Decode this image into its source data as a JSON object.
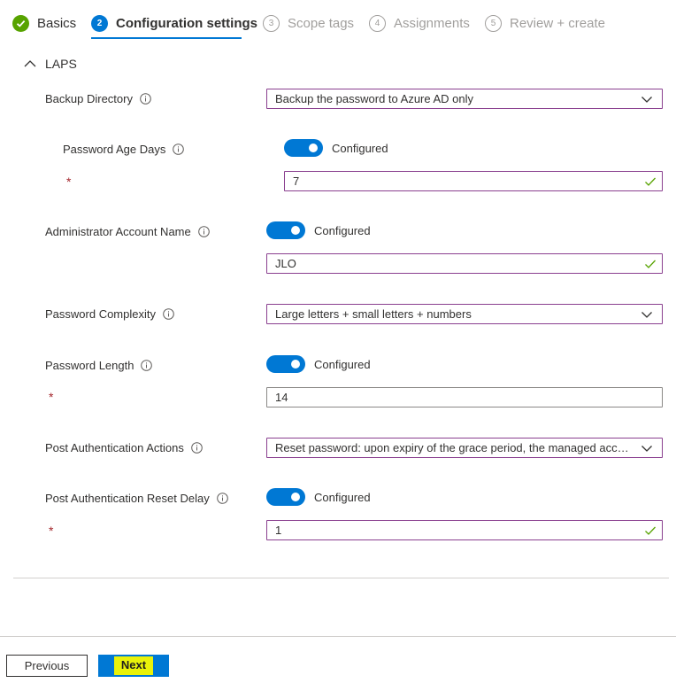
{
  "wizard": {
    "steps": [
      {
        "number": "",
        "label": "Basics",
        "state": "done"
      },
      {
        "number": "2",
        "label": "Configuration settings",
        "state": "active"
      },
      {
        "number": "3",
        "label": "Scope tags",
        "state": "future"
      },
      {
        "number": "4",
        "label": "Assignments",
        "state": "future"
      },
      {
        "number": "5",
        "label": "Review + create",
        "state": "future"
      }
    ]
  },
  "section": {
    "title": "LAPS"
  },
  "fields": {
    "backup_directory": {
      "label": "Backup Directory",
      "value": "Backup the password to Azure AD only"
    },
    "password_age_days": {
      "label": "Password Age Days",
      "toggle_label": "Configured",
      "required_mark": "*",
      "value": "7"
    },
    "admin_account_name": {
      "label": "Administrator Account Name",
      "toggle_label": "Configured",
      "value": "JLO"
    },
    "password_complexity": {
      "label": "Password Complexity",
      "value": "Large letters + small letters + numbers"
    },
    "password_length": {
      "label": "Password Length",
      "toggle_label": "Configured",
      "required_mark": "*",
      "value": "14"
    },
    "post_auth_actions": {
      "label": "Post Authentication Actions",
      "value": "Reset password: upon expiry of the grace period, the managed account password will be reset"
    },
    "post_auth_reset_delay": {
      "label": "Post Authentication Reset Delay",
      "toggle_label": "Configured",
      "required_mark": "*",
      "value": "1"
    }
  },
  "footer": {
    "previous_label": "Previous",
    "next_label": "Next"
  },
  "colors": {
    "accent": "#0078d4",
    "success": "#57a300",
    "focus_border": "#8a3f8f",
    "highlight": "#e9f20a"
  }
}
